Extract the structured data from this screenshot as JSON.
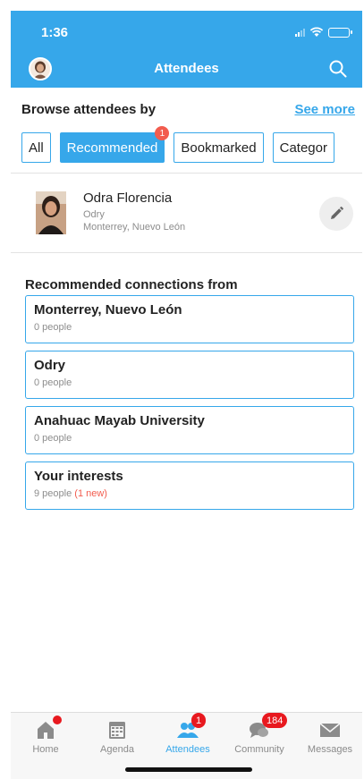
{
  "status_bar": {
    "time": "1:36"
  },
  "header": {
    "title": "Attendees"
  },
  "browse": {
    "label": "Browse attendees by",
    "see_more": "See more",
    "filters": [
      {
        "label": "All",
        "badge": ""
      },
      {
        "label": "Recommended",
        "badge": "1"
      },
      {
        "label": "Bookmarked",
        "badge": ""
      },
      {
        "label": "Categor",
        "badge": ""
      }
    ],
    "active_filter": "Recommended"
  },
  "profile": {
    "name": "Odra Florencia",
    "subtitle": "Odry",
    "location": "Monterrey, Nuevo León"
  },
  "recommended": {
    "title": "Recommended connections from",
    "items": [
      {
        "title": "Monterrey, Nuevo León",
        "count": "0 people",
        "new": ""
      },
      {
        "title": "Odry",
        "count": "0 people",
        "new": ""
      },
      {
        "title": "Anahuac Mayab University",
        "count": "0 people",
        "new": ""
      },
      {
        "title": "Your interests",
        "count": "9 people",
        "new": "(1 new)"
      }
    ]
  },
  "tabbar": {
    "tabs": [
      {
        "label": "Home",
        "icon": "home-icon",
        "badge": "dot"
      },
      {
        "label": "Agenda",
        "icon": "calendar-icon",
        "badge": ""
      },
      {
        "label": "Attendees",
        "icon": "people-icon",
        "badge": "1"
      },
      {
        "label": "Community",
        "icon": "chat-icon",
        "badge": "184"
      },
      {
        "label": "Messages",
        "icon": "envelope-icon",
        "badge": ""
      }
    ],
    "active": "Attendees"
  },
  "colors": {
    "accent": "#36a7ea",
    "badge_red": "#e8191f",
    "new_red": "#f25c4e",
    "muted_text": "#8d8d8d"
  }
}
